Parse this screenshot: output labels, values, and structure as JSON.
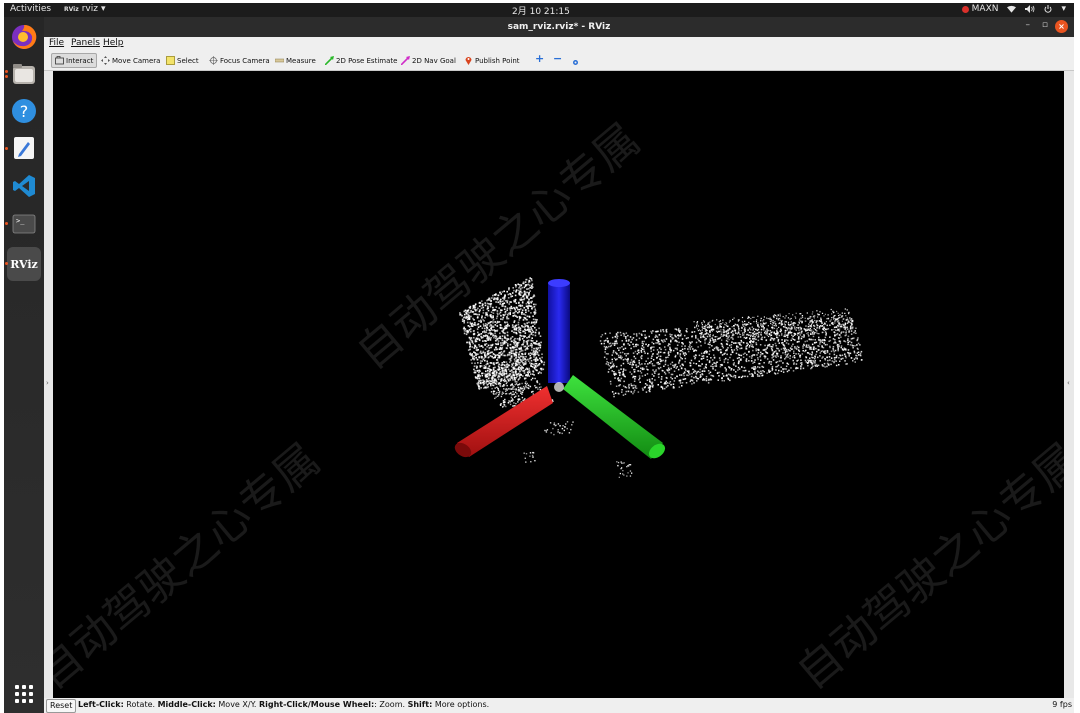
{
  "topbar": {
    "activities": "Activities",
    "app_name": "rviz",
    "app_logo": "RViz",
    "clock": "2月 10  21:15",
    "maxn": "MAXN",
    "icons": [
      "wifi-icon",
      "volume-icon",
      "power-icon",
      "chevron-down-icon"
    ]
  },
  "dock": {
    "items": [
      "firefox-icon",
      "files-icon",
      "help-icon",
      "text-editor-icon",
      "vscode-icon",
      "terminal-icon",
      "rviz-icon"
    ],
    "rviz_label": "RViz",
    "show_apps": "show-applications-icon"
  },
  "window": {
    "title": "sam_rviz.rviz* - RViz",
    "minimize": "–",
    "maximize": "▫",
    "close": "×"
  },
  "menu": {
    "file": "File",
    "panels": "Panels",
    "help": "Help"
  },
  "toolbar": {
    "interact": "Interact",
    "move_camera": "Move Camera",
    "select": "Select",
    "focus_camera": "Focus Camera",
    "measure": "Measure",
    "pose_estimate": "2D Pose Estimate",
    "nav_goal": "2D Nav Goal",
    "publish_point": "Publish Point",
    "plus": "+",
    "minus": "−"
  },
  "status": {
    "reset": "Reset",
    "k1": "Left-Click:",
    "v1": " Rotate. ",
    "k2": "Middle-Click:",
    "v2": " Move X/Y. ",
    "k3": "Right-Click/Mouse Wheel:",
    "v3": ": Zoom. ",
    "k4": "Shift:",
    "v4": " More options.",
    "fps": "9 fps"
  },
  "watermark": "自动驾驶之心专属",
  "colors": {
    "accent": "#e95420",
    "viewport_bg": "#000000",
    "axis_x": "#d21e1e",
    "axis_y": "#1fb51f",
    "axis_z": "#1414c8",
    "points": "#ffffff"
  }
}
